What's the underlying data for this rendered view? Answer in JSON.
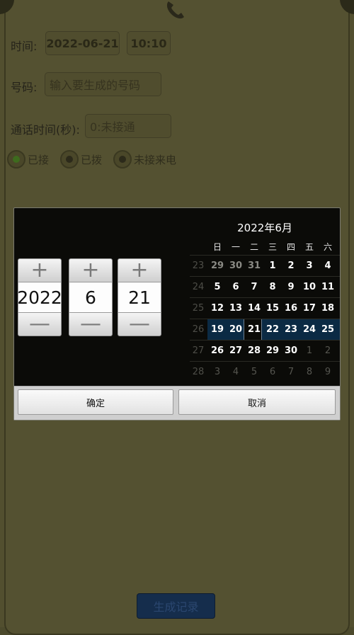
{
  "form": {
    "time_label": "时间:",
    "date_value": "2022-06-21",
    "time_value": "10:10",
    "number_label": "号码:",
    "number_placeholder": "输入要生成的号码",
    "duration_label": "通话时间(秒):",
    "duration_placeholder": "0:未接通",
    "radios": [
      {
        "label": "已接",
        "selected": true
      },
      {
        "label": "已拨",
        "selected": false
      },
      {
        "label": "未接来电",
        "selected": false
      }
    ],
    "generate_label": "生成记录"
  },
  "dialog": {
    "spinners": [
      {
        "value": "2022"
      },
      {
        "value": "6"
      },
      {
        "value": "21"
      }
    ],
    "plus_symbol": "+",
    "minus_symbol": "—",
    "calendar": {
      "title": "2022年6月",
      "weekdays": [
        "日",
        "一",
        "二",
        "三",
        "四",
        "五",
        "六"
      ],
      "weeks": [
        {
          "num": "23",
          "days": [
            "29",
            "30",
            "31",
            "1",
            "2",
            "3",
            "4"
          ]
        },
        {
          "num": "24",
          "days": [
            "5",
            "6",
            "7",
            "8",
            "9",
            "10",
            "11"
          ]
        },
        {
          "num": "25",
          "days": [
            "12",
            "13",
            "14",
            "15",
            "16",
            "17",
            "18"
          ]
        },
        {
          "num": "26",
          "days": [
            "19",
            "20",
            "21",
            "22",
            "23",
            "24",
            "25"
          ]
        },
        {
          "num": "27",
          "days": [
            "26",
            "27",
            "28",
            "29",
            "30",
            "1",
            "2"
          ]
        },
        {
          "num": "28",
          "days": [
            "3",
            "4",
            "5",
            "6",
            "7",
            "8",
            "9"
          ]
        }
      ],
      "selected_day": "21"
    },
    "confirm_label": "确定",
    "cancel_label": "取消"
  },
  "colors": {
    "selected_week_bg": "#0b2a44",
    "radio_selected": "#3e6b1e",
    "generate_button": "#152d4c"
  }
}
